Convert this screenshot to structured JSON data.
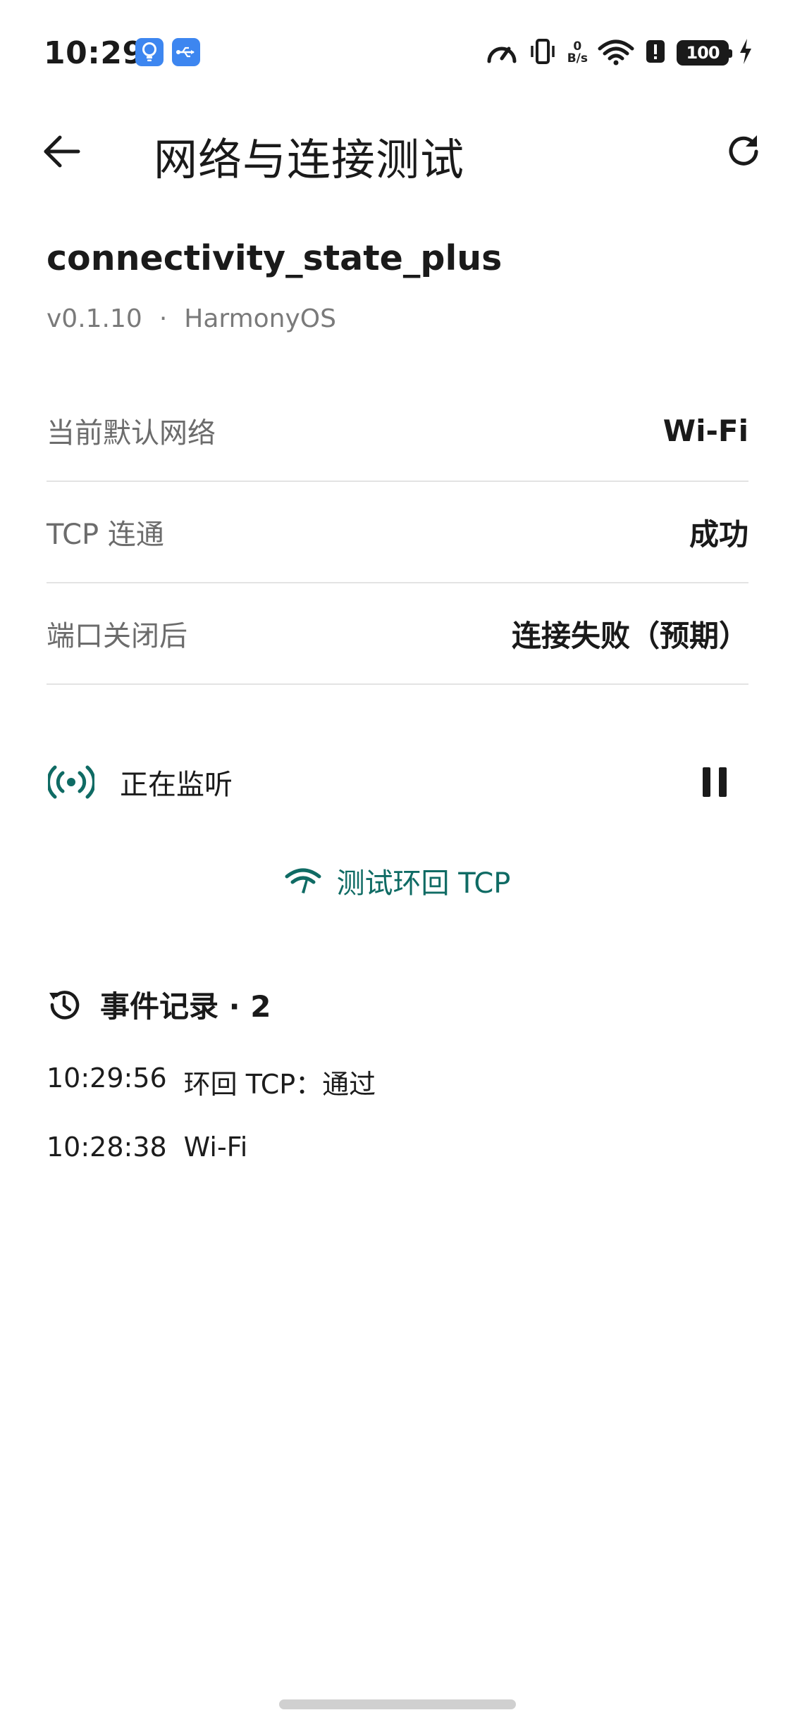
{
  "status_bar": {
    "time": "10:29",
    "net_speed_value": "0",
    "net_speed_unit": "B/s",
    "battery": "100"
  },
  "app_bar": {
    "title": "网络与连接测试"
  },
  "package": {
    "name": "connectivity_state_plus",
    "version": "v0.1.10",
    "separator": "·",
    "platform": "HarmonyOS"
  },
  "info_rows": [
    {
      "label": "当前默认网络",
      "value": "Wi-Fi"
    },
    {
      "label": "TCP 连通",
      "value": "成功"
    },
    {
      "label": "端口关闭后",
      "value": "连接失败（预期）"
    }
  ],
  "monitor": {
    "label": "正在监听"
  },
  "test_button": {
    "label": "测试环回 TCP"
  },
  "events": {
    "title": "事件记录 · 2",
    "items": [
      {
        "time": "10:29:56",
        "text": "环回 TCP：通过"
      },
      {
        "time": "10:28:38",
        "text": "Wi-Fi"
      }
    ]
  },
  "colors": {
    "accent": "#0f6b64",
    "status_icon_blue": "#3d86f0"
  }
}
